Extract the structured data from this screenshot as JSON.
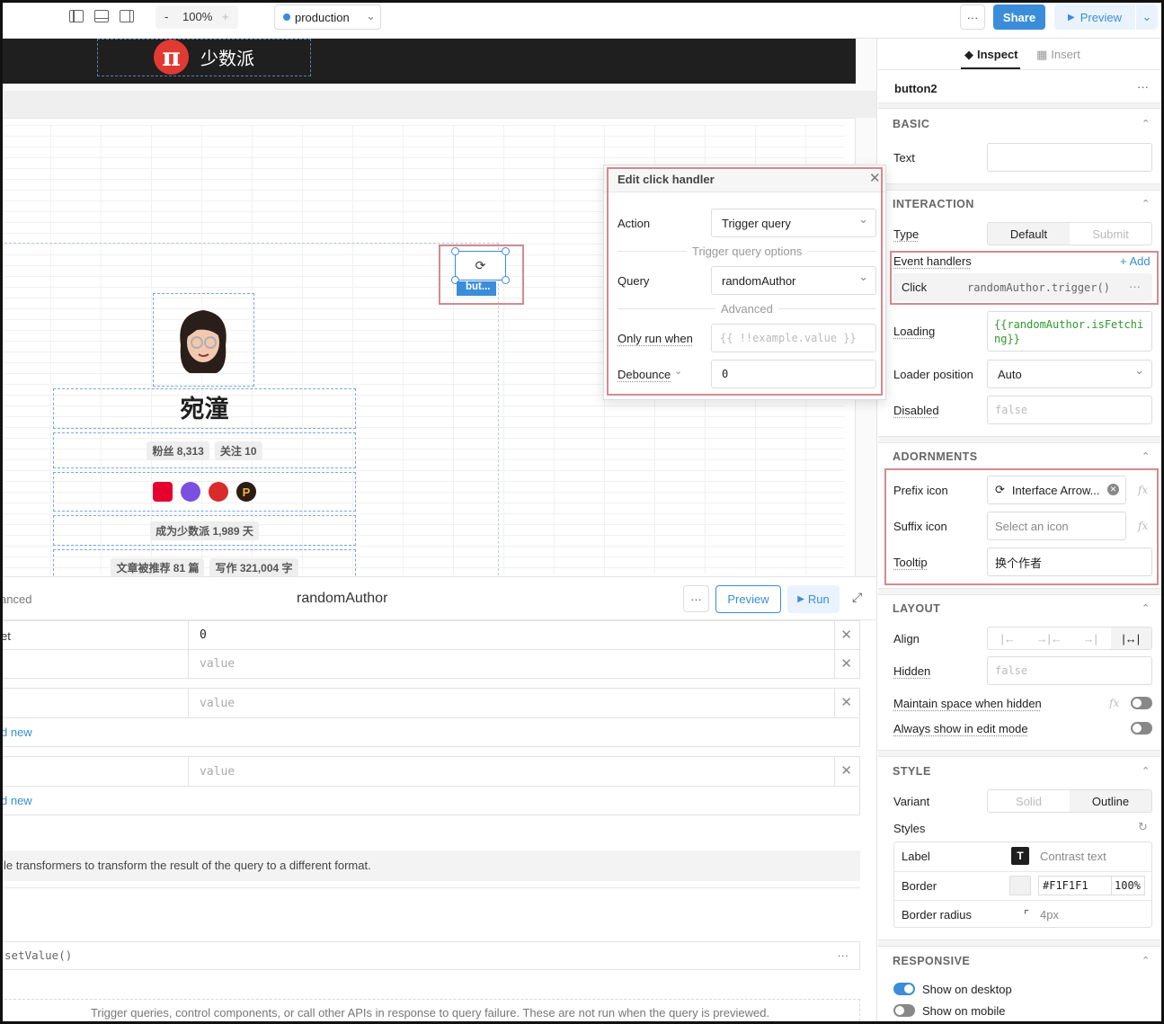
{
  "toolbar": {
    "zoom_minus": "-",
    "zoom": "100%",
    "zoom_plus": "+",
    "environment": "production",
    "more": "···",
    "share": "Share",
    "preview": "Preview"
  },
  "canvas": {
    "brand_logo": "π",
    "brand_name": "少数派",
    "profile_name": "宛潼",
    "stats_followers": "粉丝 8,313",
    "stats_following": "关注 10",
    "member_days": "成为少数派 1,989 天",
    "stats_recommended": "文章被推荐 81 篇",
    "stats_words": "写作 321,004 字",
    "button_tag": "but..."
  },
  "popover": {
    "title": "Edit click handler",
    "action_label": "Action",
    "action_value": "Trigger query",
    "options_divider": "Trigger query options",
    "query_label": "Query",
    "query_value": "randomAuthor",
    "advanced_divider": "Advanced",
    "only_run_label": "Only run when",
    "only_run_placeholder": "{{ !!example.value }}",
    "debounce_label": "Debounce",
    "debounce_value": "0"
  },
  "query_panel": {
    "left_tab_fragment": "anced",
    "title": "randomAuthor",
    "more": "···",
    "preview": "Preview",
    "run": "Run",
    "row1_key": "et",
    "row1_value": "0",
    "value_placeholder": "value",
    "add_new": "d new",
    "transformer_text": "le transformers to transform the result of the query to a different format.",
    "set_value": "setValue()",
    "failure_text": "Trigger queries, control components, or call other APIs in response to query failure. These are not run when the query is previewed."
  },
  "inspector": {
    "tab_inspect": "Inspect",
    "tab_insert": "Insert",
    "component_name": "button2",
    "more": "···",
    "basic": {
      "title": "BASIC",
      "text_label": "Text"
    },
    "interaction": {
      "title": "INTERACTION",
      "type_label": "Type",
      "type_default": "Default",
      "type_submit": "Submit",
      "event_handlers_label": "Event handlers",
      "add": "+ Add",
      "click_event": "Click",
      "click_action": "randomAuthor.trigger()",
      "loading_label": "Loading",
      "loading_value": "{{randomAuthor.isFetching}}",
      "loader_position_label": "Loader position",
      "loader_position_value": "Auto",
      "disabled_label": "Disabled",
      "disabled_value": "false"
    },
    "adornments": {
      "title": "ADORNMENTS",
      "prefix_icon_label": "Prefix icon",
      "prefix_icon_value": "Interface Arrow...",
      "suffix_icon_label": "Suffix icon",
      "suffix_icon_placeholder": "Select an icon",
      "tooltip_label": "Tooltip",
      "tooltip_value": "换个作者",
      "fx": "fx"
    },
    "layout": {
      "title": "LAYOUT",
      "align_label": "Align",
      "hidden_label": "Hidden",
      "hidden_value": "false",
      "maintain_space_label": "Maintain space when hidden",
      "always_show_label": "Always show in edit mode"
    },
    "style": {
      "title": "STYLE",
      "variant_label": "Variant",
      "variant_solid": "Solid",
      "variant_outline": "Outline",
      "styles_label": "Styles",
      "label_row": "Label",
      "label_value": "Contrast text",
      "border_row": "Border",
      "border_color": "#F1F1F1",
      "border_opacity": "100%",
      "radius_row": "Border radius",
      "radius_value": "4px"
    },
    "responsive": {
      "title": "RESPONSIVE",
      "desktop_label": "Show on desktop",
      "mobile_label": "Show on mobile"
    }
  },
  "colors": {
    "accent": "#3b8dd9",
    "highlight": "#d48a8f",
    "header_bg": "#1f1f1f",
    "logo_red": "#e03a32"
  }
}
